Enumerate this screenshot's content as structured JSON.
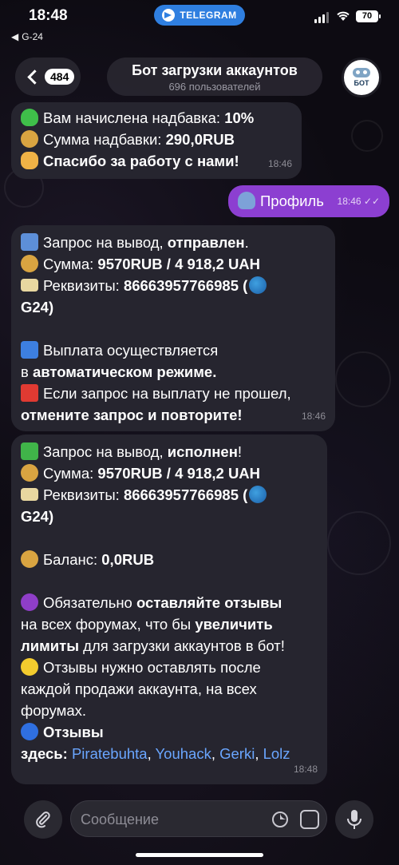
{
  "status_bar": {
    "time": "18:48",
    "app_pill": "TELEGRAM",
    "back_app": "G-24",
    "battery": "70"
  },
  "header": {
    "unread_count": "484",
    "title": "Бот загрузки аккаунтов",
    "subtitle": "696 пользователей",
    "avatar_label": "БОТ"
  },
  "messages": {
    "bonus": {
      "line1_text": "Вам начислена надбавка: ",
      "line1_value": "10%",
      "line2_text": "Сумма надбавки: ",
      "line2_value": "290,0RUB",
      "line3_value": "Спасибо за работу с нами!",
      "time": "18:46"
    },
    "profile": {
      "text": "Профиль",
      "time": "18:46"
    },
    "withdraw_sent": {
      "l1_text": "Запрос на вывод, ",
      "l1_value": "отправлен",
      "l1_end": ".",
      "l2_text": "Сумма: ",
      "l2_value": "9570RUB  / 4 918,2 UAH",
      "l3_text": "Реквизиты: ",
      "l3_value": "86663957766985 (",
      "l4_value": "G24)",
      "l5_text": "Выплата осуществляется",
      "l6_text": "в ",
      "l6_value": "автоматическом режиме.",
      "l7_text": "Если запрос на выплату не прошел,",
      "l8_value": "отмените запрос и повторите!",
      "time": "18:46"
    },
    "withdraw_done": {
      "l1_text": "Запрос на вывод, ",
      "l1_value": "исполнен",
      "l1_end": "!",
      "l2_text": "Сумма: ",
      "l2_value": "9570RUB  / 4 918,2 UAH",
      "l3_text": "Реквизиты: ",
      "l3_value": "86663957766985 (",
      "l4_value": "G24)",
      "l5_text": "Баланс: ",
      "l5_value": "0,0RUB",
      "l6_text": "Обязательно ",
      "l6_value": "оставляйте отзывы",
      "l7_text": "на всех форумах, что бы ",
      "l7_value": "увеличить",
      "l8_value": "лимиты",
      "l8_text": " для загрузки аккаунтов в бот!",
      "l9_text": "Отзывы нужно оставлять после",
      "l10_text": "каждой продажи аккаунта, на всех",
      "l11_text": "форумах.",
      "l12_value": "Отзывы",
      "l13_value": "здесь: ",
      "links": [
        "Piratebuhta",
        "Youhack",
        "Gerki",
        "Lolz"
      ],
      "sep": ", ",
      "time": "18:48"
    }
  },
  "composer": {
    "placeholder": "Сообщение"
  },
  "colors": {
    "outgoing": "#8c3fd1",
    "incoming": "#26252f",
    "link": "#6aa6ff"
  }
}
